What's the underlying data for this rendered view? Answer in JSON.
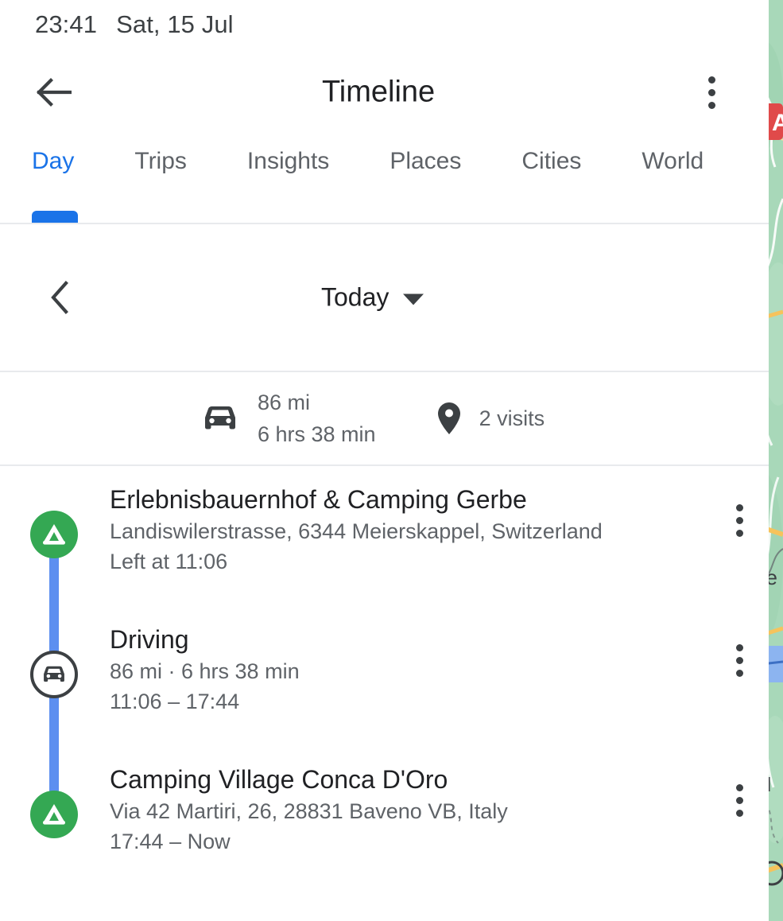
{
  "status_bar": {
    "time": "23:41",
    "date": "Sat, 15 Jul"
  },
  "app_bar": {
    "title": "Timeline",
    "back_icon": "arrow-left-icon",
    "overflow_icon": "more-vert-icon"
  },
  "tabs": {
    "items": [
      {
        "label": "Day",
        "active": true
      },
      {
        "label": "Trips",
        "active": false
      },
      {
        "label": "Insights",
        "active": false
      },
      {
        "label": "Places",
        "active": false
      },
      {
        "label": "Cities",
        "active": false
      },
      {
        "label": "World",
        "active": false
      }
    ],
    "active_color": "#1a73e8",
    "inactive_color": "#5f6368"
  },
  "day_selector": {
    "prev_icon": "chevron-left-icon",
    "label": "Today",
    "dropdown_icon": "caret-down-icon"
  },
  "summary": {
    "distance": "86 mi",
    "duration": "6 hrs 38 min",
    "visits": "2 visits",
    "drive_icon": "car-icon",
    "place_icon": "map-pin-icon"
  },
  "timeline": {
    "entries": [
      {
        "kind": "place",
        "icon": "campground-tent-icon",
        "marker_color": "#34a853",
        "title": "Erlebnisbauernhof & Camping Gerbe",
        "address": "Landiswilerstrasse, 6344 Meierskappel, Switzerland",
        "time": "Left at 11:06",
        "menu_icon": "more-vert-icon"
      },
      {
        "kind": "activity",
        "icon": "car-icon",
        "marker_color": "#ffffff",
        "title": "Driving",
        "address": "86 mi · 6 hrs 38 min",
        "time": "11:06 – 17:44",
        "menu_icon": "more-vert-icon"
      },
      {
        "kind": "place",
        "icon": "campground-tent-icon",
        "marker_color": "#34a853",
        "title": "Camping Village Conca D'Oro",
        "address": "Via 42 Martiri, 26, 28831 Baveno VB, Italy",
        "time": "17:44 – Now",
        "menu_icon": "more-vert-icon"
      }
    ],
    "connector_color": "#5d8ff0"
  },
  "map_strip": {
    "description": "partially visible map behind panel",
    "land_color": "#a8d8b9",
    "water_color": "#8cb4f0",
    "road_color": "#f6c35c",
    "label_badge_color": "#e04a4a"
  }
}
